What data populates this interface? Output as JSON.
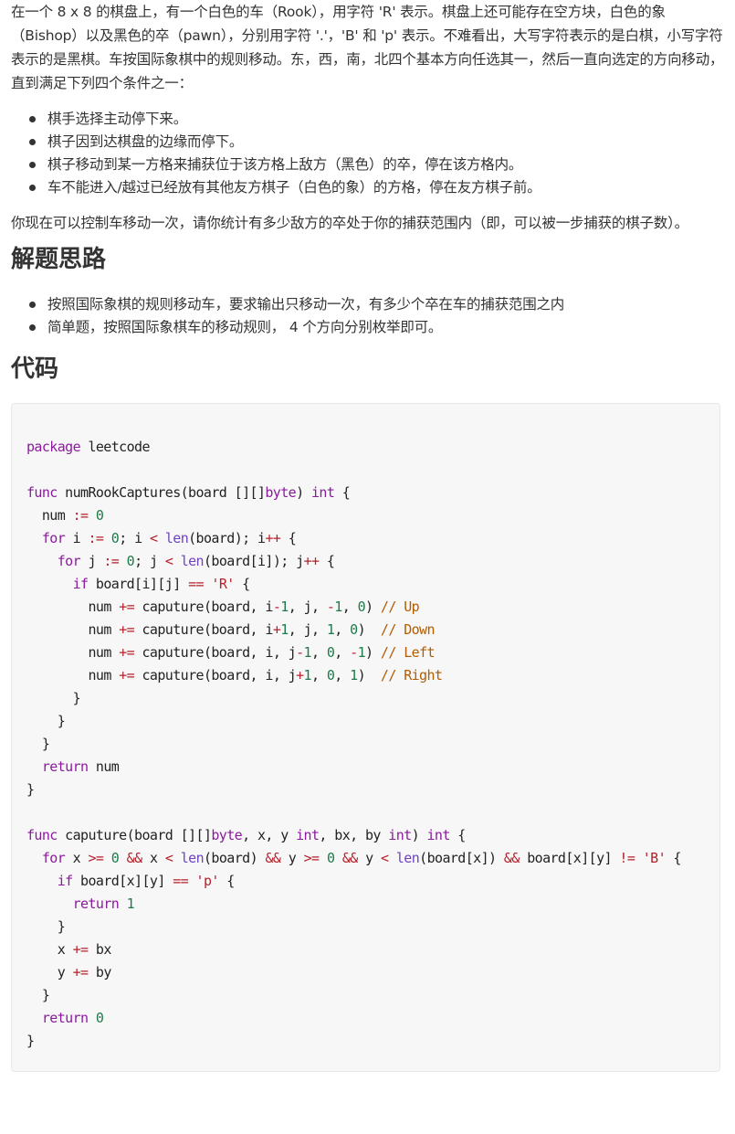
{
  "intro": {
    "paragraph1": "在一个 8 x 8 的棋盘上，有一个白色的车（Rook），用字符 'R' 表示。棋盘上还可能存在空方块，白色的象（Bishop）以及黑色的卒（pawn），分别用字符 '.'，'B' 和 'p' 表示。不难看出，大写字符表示的是白棋，小写字符表示的是黑棋。车按国际象棋中的规则移动。东，西，南，北四个基本方向任选其一，然后一直向选定的方向移动，直到满足下列四个条件之一：",
    "conditions": [
      "棋手选择主动停下来。",
      "棋子因到达棋盘的边缘而停下。",
      "棋子移动到某一方格来捕获位于该方格上敌方（黑色）的卒，停在该方格内。",
      "车不能进入/越过已经放有其他友方棋子（白色的象）的方格，停在友方棋子前。"
    ],
    "paragraph2": "你现在可以控制车移动一次，请你统计有多少敌方的卒处于你的捕获范围内（即，可以被一步捕获的棋子数）。"
  },
  "approach": {
    "heading": "解题思路",
    "points": [
      "按照国际象棋的规则移动车，要求输出只移动一次，有多少个卒在车的捕获范围之内",
      "简单题，按照国际象棋车的移动规则， 4 个方向分别枚举即可。"
    ]
  },
  "code_section": {
    "heading": "代码",
    "language": "go",
    "lines": [
      "package leetcode",
      "",
      "func numRookCaptures(board [][]byte) int {",
      "  num := 0",
      "  for i := 0; i < len(board); i++ {",
      "    for j := 0; j < len(board[i]); j++ {",
      "      if board[i][j] == 'R' {",
      "        num += caputure(board, i-1, j, -1, 0) // Up",
      "        num += caputure(board, i+1, j, 1, 0)  // Down",
      "        num += caputure(board, i, j-1, 0, -1) // Left",
      "        num += caputure(board, i, j+1, 0, 1)  // Right",
      "      }",
      "    }",
      "  }",
      "  return num",
      "}",
      "",
      "func caputure(board [][]byte, x, y int, bx, by int) int {",
      "  for x >= 0 && x < len(board) && y >= 0 && y < len(board[x]) && board[x][y] != 'B' {",
      "    if board[x][y] == 'p' {",
      "      return 1",
      "    }",
      "    x += bx",
      "    y += by",
      "  }",
      "  return 0",
      "}"
    ]
  }
}
